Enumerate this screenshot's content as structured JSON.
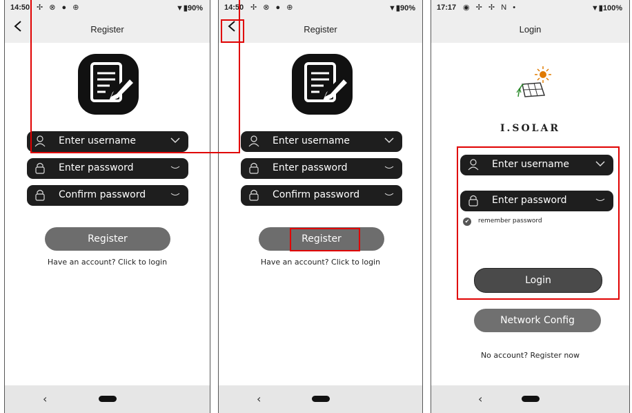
{
  "screens": [
    {
      "status": {
        "time": "14:50",
        "icons": "✢ ⊗ ● ⊕",
        "battery": "▼▮90%"
      },
      "header": {
        "back_icon": "chevron-left-icon",
        "title": "Register"
      },
      "form": {
        "username_placeholder": "Enter username",
        "password_placeholder": "Enter password",
        "confirm_placeholder": "Confirm password"
      },
      "register_button": "Register",
      "login_link": "Have an account? Click to login",
      "nav": {
        "back": "‹"
      }
    },
    {
      "status": {
        "time": "14:50",
        "icons": "✢ ⊗ ● ⊕",
        "battery": "▼▮90%"
      },
      "header": {
        "back_icon": "chevron-left-icon",
        "title": "Register"
      },
      "form": {
        "username_placeholder": "Enter username",
        "password_placeholder": "Enter password",
        "confirm_placeholder": "Confirm password"
      },
      "register_button": "Register",
      "login_link": "Have an account? Click to login",
      "nav": {
        "back": "‹"
      }
    },
    {
      "status": {
        "time": "17:17",
        "icons": "◉ ✢ ✢ N •",
        "battery": "▼▮100%"
      },
      "header": {
        "title": "Login"
      },
      "brand": "I.SOLAR",
      "form": {
        "username_placeholder": "Enter username",
        "password_placeholder": "Enter password",
        "remember_label": "remember password"
      },
      "login_button": "Login",
      "network_button": "Network Config",
      "register_link": "No account? Register now",
      "nav": {
        "back": "‹"
      }
    }
  ],
  "colors": {
    "field": "#1e1e1e",
    "button": "#6d6d6d",
    "highlight": "#e00000",
    "bar": "#eeeeee"
  }
}
